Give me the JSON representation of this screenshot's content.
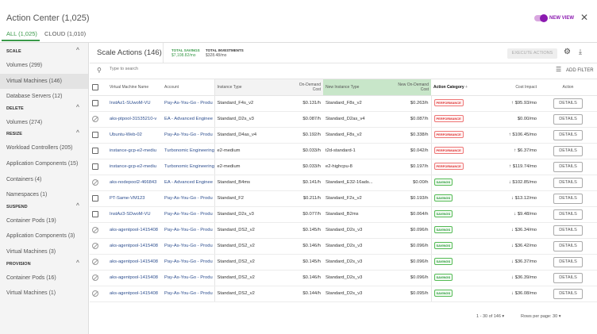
{
  "header": {
    "title": "Action Center (1,025)",
    "tabs": [
      {
        "label": "ALL (1,025)"
      },
      {
        "label": "CLOUD (1,010)"
      }
    ],
    "new_view_label": "NEW VIEW",
    "new_view_on": true
  },
  "sidebar": {
    "sections": [
      {
        "label": "SCALE",
        "items": [
          {
            "label": "Volumes (299)"
          },
          {
            "label": "Virtual Machines (146)",
            "selected": true
          },
          {
            "label": "Database Servers (12)"
          }
        ]
      },
      {
        "label": "DELETE",
        "items": [
          {
            "label": "Volumes (274)"
          }
        ]
      },
      {
        "label": "RESIZE",
        "items": [
          {
            "label": "Workload Controllers (205)"
          },
          {
            "label": "Application Components (15)"
          },
          {
            "label": "Containers (4)"
          },
          {
            "label": "Namespaces (1)"
          }
        ]
      },
      {
        "label": "SUSPEND",
        "items": [
          {
            "label": "Container Pods (19)"
          },
          {
            "label": "Application Components (3)"
          },
          {
            "label": "Virtual Machines (3)"
          }
        ]
      },
      {
        "label": "PROVISION",
        "items": [
          {
            "label": "Container Pods (16)"
          },
          {
            "label": "Virtual Machines (1)"
          }
        ]
      }
    ]
  },
  "main": {
    "title": "Scale Actions (146)",
    "total_savings_label": "TOTAL SAVINGS",
    "total_savings": "$7,108.82/mo",
    "total_investments_label": "TOTAL INVESTMENTS",
    "total_investments": "$328.48/mo",
    "execute_label": "EXECUTE ACTIONS",
    "search_placeholder": "Type to search",
    "add_filter_label": "ADD FILTER"
  },
  "table": {
    "columns": [
      "Virtual Machine Name",
      "Account",
      "Instance Type",
      "On-Demand Cost",
      "New Instance Type",
      "New On-Demand Cost",
      "Action Category",
      "Cost Impact",
      "Action"
    ],
    "rows": [
      {
        "sel": "checkbox",
        "name": "InstAz1-SUwoM-VU",
        "account": "Pay-As-You-Go - Produ",
        "type": "Standard_F4s_v2",
        "cost": "$0.131/h",
        "new_type": "Standard_F8s_v2",
        "new_cost": "$0.263/h",
        "category": "PERFORMANCE",
        "impact": "↑ $95.93/mo",
        "action": "DETAILS"
      },
      {
        "sel": "disabled",
        "name": "aks-ptpool-31535210-v",
        "account": "EA - Advanced Enginee",
        "type": "Standard_D2s_v3",
        "cost": "$0.087/h",
        "new_type": "Standard_D2as_v4",
        "new_cost": "$0.087/h",
        "category": "PERFORMANCE",
        "impact": "$0.00/mo",
        "action": "DETAILS"
      },
      {
        "sel": "checkbox",
        "name": "Ubuntu-Web-02",
        "account": "Pay-As-You-Go - Produ",
        "type": "Standard_D4as_v4",
        "cost": "$0.192/h",
        "new_type": "Standard_F8s_v2",
        "new_cost": "$0.338/h",
        "category": "PERFORMANCE",
        "impact": "↑ $106.45/mo",
        "action": "DETAILS"
      },
      {
        "sel": "checkbox",
        "name": "instance-gcp-e2-mediu",
        "account": "Turbonomic Engineering",
        "type": "e2-medium",
        "cost": "$0.033/h",
        "new_type": "t2d-standard-1",
        "new_cost": "$0.042/h",
        "category": "PERFORMANCE",
        "impact": "↑ $6.37/mo",
        "action": "DETAILS"
      },
      {
        "sel": "checkbox",
        "name": "instance-gcp-e2-mediu",
        "account": "Turbonomic Engineering",
        "type": "e2-medium",
        "cost": "$0.033/h",
        "new_type": "e2-highcpu-8",
        "new_cost": "$0.197/h",
        "category": "PERFORMANCE",
        "impact": "↑ $119.74/mo",
        "action": "DETAILS"
      },
      {
        "sel": "disabled",
        "name": "aks-nodepool2-466843",
        "account": "EA - Advanced Enginee",
        "type": "Standard_B4ms",
        "cost": "$0.141/h",
        "new_type": "Standard_E32-16ads...",
        "new_cost": "$0.00/h",
        "category": "SAVINGS",
        "impact": "↓ $102.85/mo",
        "action": "DETAILS"
      },
      {
        "sel": "checkbox",
        "name": "PT-Same-VM123",
        "account": "Pay-As-You-Go - Produ",
        "type": "Standard_F2",
        "cost": "$0.211/h",
        "new_type": "Standard_F2s_v2",
        "new_cost": "$0.193/h",
        "category": "SAVINGS",
        "impact": "↓ $13.12/mo",
        "action": "DETAILS"
      },
      {
        "sel": "checkbox",
        "name": "InstAz3-SDwoM-VU",
        "account": "Pay-As-You-Go - Produ",
        "type": "Standard_D2s_v3",
        "cost": "$0.077/h",
        "new_type": "Standard_B2ms",
        "new_cost": "$0.064/h",
        "category": "SAVINGS",
        "impact": "↓ $9.48/mo",
        "action": "DETAILS"
      },
      {
        "sel": "disabled",
        "name": "aks-agentpool-1415408",
        "account": "Pay-As-You-Go - Produ",
        "type": "Standard_DS2_v2",
        "cost": "$0.145/h",
        "new_type": "Standard_D2s_v3",
        "new_cost": "$0.096/h",
        "category": "SAVINGS",
        "impact": "↓ $36.34/mo",
        "action": "DETAILS"
      },
      {
        "sel": "disabled",
        "name": "aks-agentpool-1415408",
        "account": "Pay-As-You-Go - Produ",
        "type": "Standard_DS2_v2",
        "cost": "$0.146/h",
        "new_type": "Standard_D2s_v3",
        "new_cost": "$0.096/h",
        "category": "SAVINGS",
        "impact": "↓ $36.42/mo",
        "action": "DETAILS"
      },
      {
        "sel": "disabled",
        "name": "aks-agentpool-1415408",
        "account": "Pay-As-You-Go - Produ",
        "type": "Standard_DS2_v2",
        "cost": "$0.145/h",
        "new_type": "Standard_D2s_v3",
        "new_cost": "$0.096/h",
        "category": "SAVINGS",
        "impact": "↓ $36.37/mo",
        "action": "DETAILS"
      },
      {
        "sel": "disabled",
        "name": "aks-agentpool-1415408",
        "account": "Pay-As-You-Go - Produ",
        "type": "Standard_DS2_v2",
        "cost": "$0.146/h",
        "new_type": "Standard_D2s_v3",
        "new_cost": "$0.096/h",
        "category": "SAVINGS",
        "impact": "↓ $36.39/mo",
        "action": "DETAILS"
      },
      {
        "sel": "disabled",
        "name": "aks-agentpool-1415408",
        "account": "Pay-As-You-Go - Produ",
        "type": "Standard_DS2_v2",
        "cost": "$0.144/h",
        "new_type": "Standard_D2s_v3",
        "new_cost": "$0.095/h",
        "category": "SAVINGS",
        "impact": "↓ $36.08/mo",
        "action": "DETAILS"
      }
    ]
  },
  "footer": {
    "range": "1 - 30 of 146",
    "rows_per_page": "Rows per page: 30"
  },
  "colors": {
    "accent_green": "#3a9a4a",
    "purple": "#8b1ab0",
    "performance": "#dd3333",
    "savings": "#2a9a3a"
  }
}
